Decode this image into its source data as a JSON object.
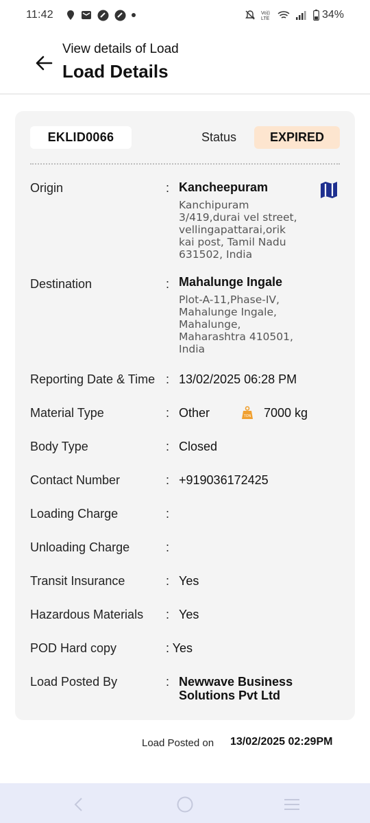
{
  "status_bar": {
    "time": "11:42",
    "battery": "34%",
    "left_icons": [
      "location-icon",
      "mail-icon",
      "app-icon",
      "app-icon",
      "dot"
    ],
    "right_icons": [
      "mute-icon",
      "volte-icon",
      "wifi-icon",
      "signal-icon",
      "battery-icon"
    ]
  },
  "header": {
    "subtitle": "View details of Load",
    "title": "Load Details"
  },
  "card": {
    "load_id": "EKLID0066",
    "status_label": "Status",
    "status_value": "EXPIRED",
    "rows": {
      "origin": {
        "label": "Origin",
        "colon": ":",
        "value": "Kancheepuram",
        "address": [
          "Kanchipuram",
          "3/419,durai vel street,",
          "vellingapattarai,orik",
          "kai post, Tamil Nadu",
          "631502, India"
        ]
      },
      "destination": {
        "label": "Destination",
        "colon": ":",
        "value": "Mahalunge Ingale",
        "address": [
          "Plot-A-11,Phase-IV,",
          "Mahalunge Ingale,",
          "Mahalunge,",
          "Maharashtra 410501,",
          "India"
        ]
      },
      "reporting": {
        "label": "Reporting Date & Time",
        "colon": ":",
        "value": "13/02/2025 06:28 PM"
      },
      "material": {
        "label": "Material Type",
        "colon": ":",
        "value": "Other",
        "weight": "7000 kg"
      },
      "body": {
        "label": "Body Type",
        "colon": ":",
        "value": "Closed"
      },
      "contact": {
        "label": "Contact Number",
        "colon": ":",
        "value": "+919036172425"
      },
      "loading": {
        "label": "Loading Charge",
        "colon": ":",
        "value": ""
      },
      "unloading": {
        "label": "Unloading Charge",
        "colon": ":",
        "value": ""
      },
      "insurance": {
        "label": "Transit Insurance",
        "colon": ":",
        "value": "Yes"
      },
      "hazardous": {
        "label": "Hazardous Materials",
        "colon": ":",
        "value": "Yes"
      },
      "pod": {
        "label": "POD Hard copy",
        "colon_value": ": Yes"
      },
      "posted_by": {
        "label": "Load Posted By",
        "colon": ":",
        "value_lines": [
          "Newwave Business",
          "Solutions Pvt Ltd"
        ]
      }
    }
  },
  "footer": {
    "posted_on_label": "Load Posted on",
    "posted_on_value": "13/02/2025 02:29PM"
  },
  "colors": {
    "card_bg": "#f4f4f4",
    "status_badge_bg": "#fde5cf",
    "map_icon": "#1e2f8f",
    "weight_icon": "#f0a030",
    "navbar_bg": "#e8ebf9"
  },
  "nav": [
    "back-nav-icon",
    "home-nav-icon",
    "recents-nav-icon"
  ]
}
